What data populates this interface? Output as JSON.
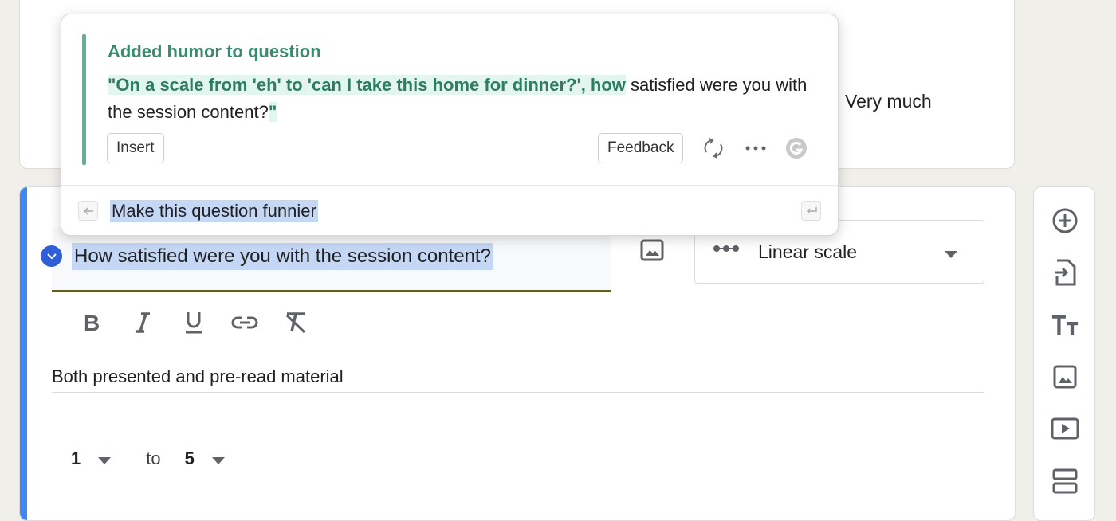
{
  "previous_question": {
    "scale_max_label": "Very much"
  },
  "question": {
    "title": "How satisfied were you with the session content?",
    "description": "Both presented and pre-read material",
    "type_selector": {
      "selected": "Linear scale",
      "icon": "linear-scale-icon"
    },
    "format_toolbar": [
      "bold-icon",
      "italic-icon",
      "underline-icon",
      "link-icon",
      "clear-format-icon"
    ],
    "scale": {
      "min": "1",
      "to_label": "to",
      "max": "5"
    }
  },
  "side_toolbar": [
    "add-question-icon",
    "import-questions-icon",
    "add-title-icon",
    "add-image-icon",
    "add-video-icon",
    "add-section-icon"
  ],
  "grammarly_popup": {
    "heading": "Added humor to question",
    "suggestion_highlight": "\"On a scale from 'eh' to 'can I take this home for dinner?', how",
    "suggestion_rest_1": " satisfied were you with the session content?",
    "suggestion_end_quote": "\"",
    "insert_label": "Insert",
    "feedback_label": "Feedback",
    "prompt_text": "Make this question funnier"
  },
  "colors": {
    "accent_blue": "#4285f4",
    "grammarly_green": "#3a8a70",
    "highlight_green": "#e2f5ef",
    "selection_blue": "#c4d7f5"
  }
}
